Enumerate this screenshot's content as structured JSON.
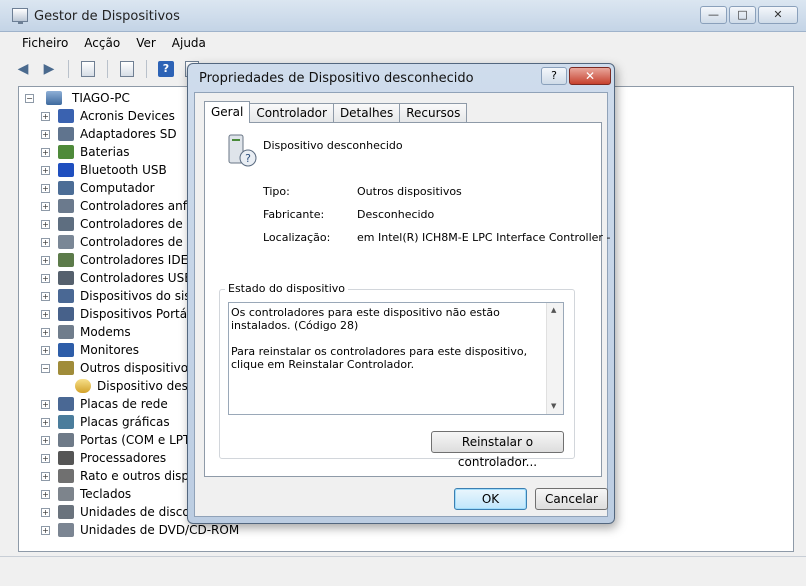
{
  "window": {
    "title": "Gestor de Dispositivos",
    "controls": {
      "minimize": "—",
      "maximize": "□",
      "close": "✕"
    }
  },
  "menu": [
    "Ficheiro",
    "Acção",
    "Ver",
    "Ajuda"
  ],
  "toolbar_icons": [
    "back-arrow-icon",
    "forward-arrow-icon",
    "properties-icon",
    "list-icon",
    "help-icon",
    "console-icon"
  ],
  "tree": {
    "root": "TIAGO-PC",
    "categories": [
      {
        "label": "Acronis Devices",
        "icon": "acronis",
        "color": "#3a62b0"
      },
      {
        "label": "Adaptadores SD",
        "icon": "sd-card",
        "color": "#60748e"
      },
      {
        "label": "Baterias",
        "icon": "battery",
        "color": "#4e8a3a"
      },
      {
        "label": "Bluetooth USB",
        "icon": "bluetooth",
        "color": "#1f4fbf"
      },
      {
        "label": "Computador",
        "icon": "computer",
        "color": "#4c6d96"
      },
      {
        "label": "Controladores anfitrião",
        "icon": "controller",
        "color": "#6b7a8d"
      },
      {
        "label": "Controladores de armazenamento",
        "icon": "storage",
        "color": "#5e6e80"
      },
      {
        "label": "Controladores de som",
        "icon": "sound",
        "color": "#7a8796"
      },
      {
        "label": "Controladores IDE ATA/ATAPI",
        "icon": "ide",
        "color": "#5c7b4a"
      },
      {
        "label": "Controladores USB (Universal Serial Bus)",
        "icon": "usb",
        "color": "#55606d"
      },
      {
        "label": "Dispositivos do sistema",
        "icon": "system",
        "color": "#4a6894"
      },
      {
        "label": "Dispositivos Portáteis",
        "icon": "portable",
        "color": "#47618a"
      },
      {
        "label": "Modems",
        "icon": "modem",
        "color": "#707d8c"
      },
      {
        "label": "Monitores",
        "icon": "monitor",
        "color": "#2e5da8"
      },
      {
        "label": "Outros dispositivos",
        "icon": "other",
        "color": "#a08c3a",
        "expanded": true,
        "children": [
          "Dispositivo desconhecido"
        ]
      },
      {
        "label": "Placas de rede",
        "icon": "network",
        "color": "#4a6894"
      },
      {
        "label": "Placas gráficas",
        "icon": "graphics",
        "color": "#4b7d9c"
      },
      {
        "label": "Portas (COM e LPT)",
        "icon": "ports",
        "color": "#6e7a88"
      },
      {
        "label": "Processadores",
        "icon": "processor",
        "color": "#555555"
      },
      {
        "label": "Rato e outros dispositivos apontadores",
        "icon": "mouse",
        "color": "#707070"
      },
      {
        "label": "Teclados",
        "icon": "keyboard",
        "color": "#7d848c"
      },
      {
        "label": "Unidades de disco",
        "icon": "disk",
        "color": "#6a737d"
      },
      {
        "label": "Unidades de DVD/CD-ROM",
        "icon": "dvd",
        "color": "#7b8592"
      }
    ]
  },
  "dialog": {
    "title": "Propriedades de Dispositivo desconhecido",
    "help": "?",
    "close": "✕",
    "tabs": [
      "Geral",
      "Controlador",
      "Detalhes",
      "Recursos"
    ],
    "active_tab": "Geral",
    "device_name": "Dispositivo desconhecido",
    "props": [
      {
        "label": "Tipo:",
        "value": "Outros dispositivos"
      },
      {
        "label": "Fabricante:",
        "value": "Desconhecido"
      },
      {
        "label": "Localização:",
        "value": "em Intel(R) ICH8M-E LPC Interface Controller -"
      }
    ],
    "status_group": "Estado do dispositivo",
    "status_line1": "Os controladores para este dispositivo não estão instalados. (Código 28)",
    "status_line2": "Para reinstalar os controladores para este dispositivo, clique em Reinstalar Controlador.",
    "reinstall_button": "Reinstalar o controlador...",
    "ok_button": "OK",
    "cancel_button": "Cancelar"
  }
}
